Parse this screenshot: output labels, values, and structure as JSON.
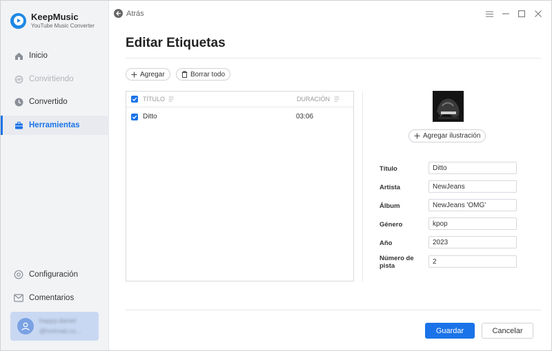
{
  "app": {
    "name": "KeepMusic",
    "subtitle": "YouTube Music Converter",
    "accent": "#1a73e8"
  },
  "sidebar": {
    "items": [
      {
        "label": "Inicio",
        "icon": "home-icon",
        "state": "normal"
      },
      {
        "label": "Convirtiendo",
        "icon": "sync-icon",
        "state": "disabled"
      },
      {
        "label": "Convertido",
        "icon": "clock-icon",
        "state": "normal"
      },
      {
        "label": "Herramientas",
        "icon": "toolbox-icon",
        "state": "active"
      }
    ],
    "bottom_items": [
      {
        "label": "Configuración",
        "icon": "gear-icon"
      },
      {
        "label": "Comentarios",
        "icon": "mail-icon"
      }
    ],
    "user": {
      "name": "happy.daniel",
      "email": "@hotmail.co..."
    }
  },
  "topbar": {
    "back_label": "Atrás",
    "controls": [
      "menu-icon",
      "minimize-icon",
      "maximize-icon",
      "close-icon"
    ]
  },
  "page": {
    "title": "Editar Etiquetas",
    "add_label": "Agregar",
    "clear_label": "Borrar todo"
  },
  "table": {
    "col_title": "TÍTULO",
    "col_duration": "DURACIÓN",
    "rows": [
      {
        "title": "Ditto",
        "duration": "03:06",
        "checked": true
      }
    ]
  },
  "tags": {
    "add_artwork_label": "Agregar ilustración",
    "fields": [
      {
        "label": "Título",
        "value": "Ditto"
      },
      {
        "label": "Artista",
        "value": "NewJeans"
      },
      {
        "label": "Álbum",
        "value": "NewJeans 'OMG'"
      },
      {
        "label": "Género",
        "value": "kpop"
      },
      {
        "label": "Año",
        "value": "2023"
      },
      {
        "label": "Número de pista",
        "value": "2"
      }
    ]
  },
  "actions": {
    "save_label": "Guardar",
    "cancel_label": "Cancelar"
  }
}
